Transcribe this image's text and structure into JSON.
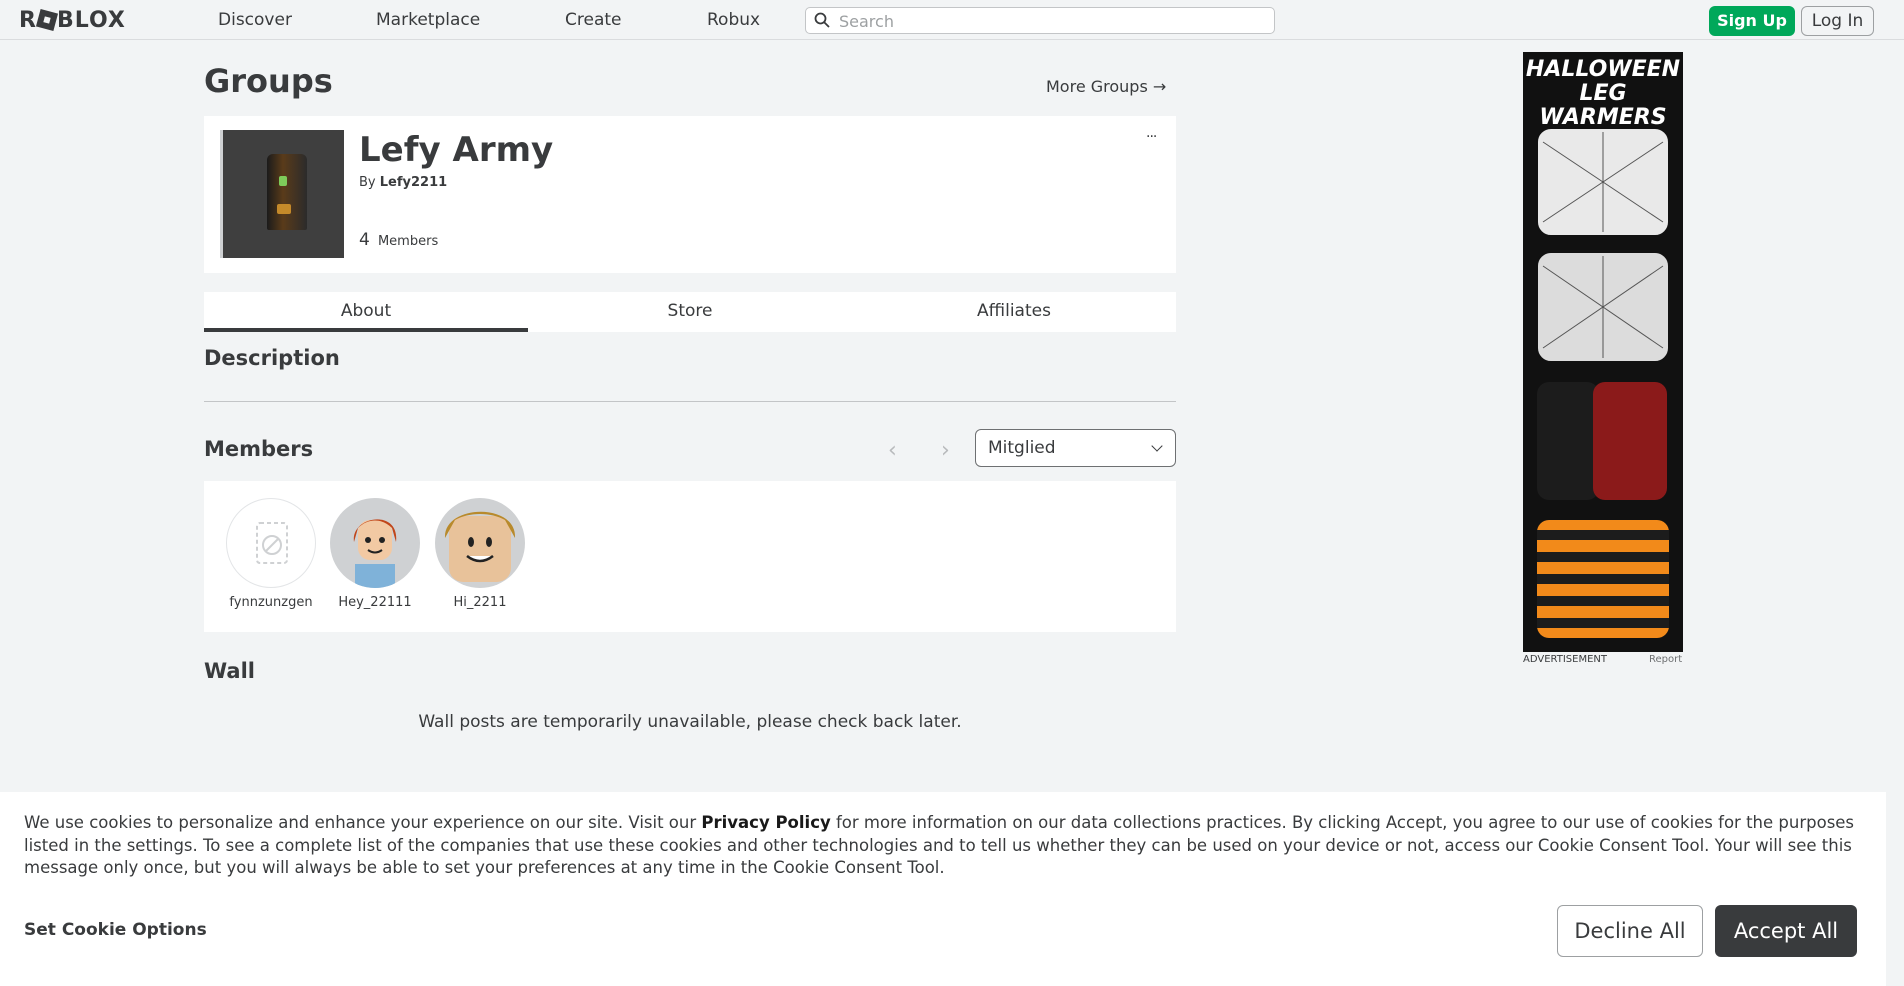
{
  "header": {
    "logo_text": "ROBLOX",
    "nav": [
      "Discover",
      "Marketplace",
      "Create",
      "Robux"
    ],
    "search_placeholder": "Search",
    "signup_label": "Sign Up",
    "login_label": "Log In"
  },
  "page": {
    "title": "Groups",
    "more_groups": "More Groups →"
  },
  "group": {
    "name": "Lefy Army",
    "by_label": "By",
    "owner": "Lefy2211",
    "member_count": "4",
    "members_label": "Members",
    "more_icon": "···"
  },
  "tabs": [
    "About",
    "Store",
    "Affiliates"
  ],
  "sections": {
    "description": "Description",
    "members": "Members",
    "wall": "Wall"
  },
  "members": {
    "prev": "‹",
    "next": "›",
    "role_selected": "Mitglied",
    "list": [
      {
        "name": "fynnzunzgen"
      },
      {
        "name": "Hey_22111"
      },
      {
        "name": "Hi_2211"
      }
    ]
  },
  "wall_message": "Wall posts are temporarily unavailable, please check back later.",
  "ad": {
    "headline_1": "HALLOWEEN",
    "headline_2": "LEG WARMERS",
    "label": "ADVERTISEMENT",
    "report": "Report"
  },
  "cookie": {
    "text_before": "We use cookies to personalize and enhance your experience on our site. Visit our ",
    "privacy_link": "Privacy Policy",
    "text_after": " for more information on our data collections practices. By clicking Accept, you agree to our use of cookies for the purposes listed in the settings. To see a complete list of the companies that use these cookies and other technologies and to tell us whether they can be used on your device or not, access our Cookie Consent Tool. Your will see this message only once, but you will always be able to set your preferences at any time in the Cookie Consent Tool.",
    "set_options": "Set Cookie Options",
    "decline": "Decline All",
    "accept": "Accept All"
  },
  "colors": {
    "signup_green": "#00a85a",
    "text_dark": "#393b3d",
    "background": "#f2f4f5"
  }
}
